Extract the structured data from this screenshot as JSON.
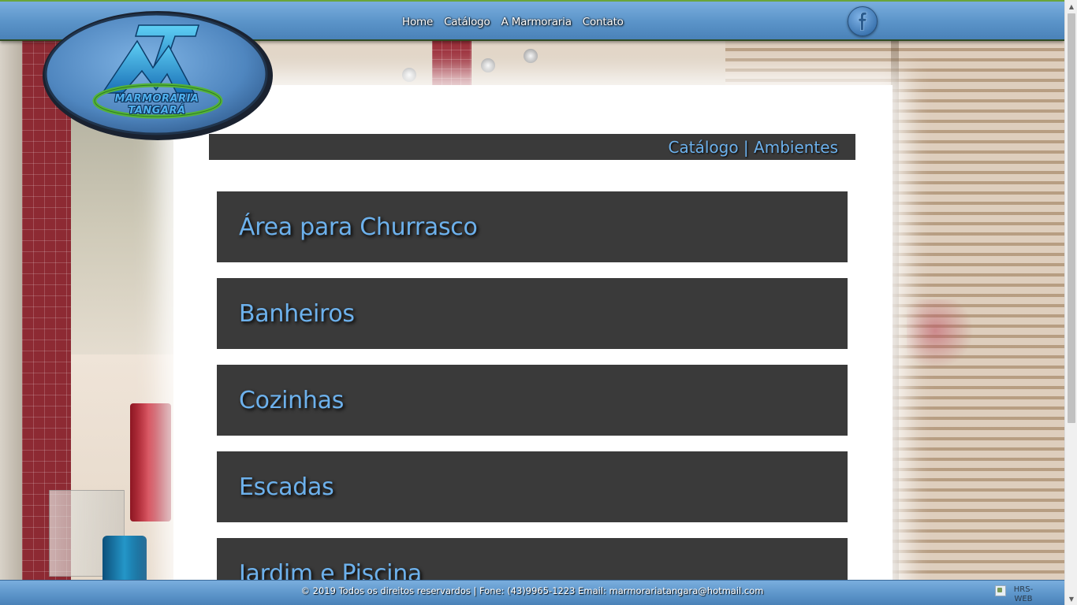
{
  "brand": {
    "logo_line1": "MARMORARIA",
    "logo_line2": "TANGARÁ",
    "logo_monogram": "TM"
  },
  "nav": {
    "items": [
      {
        "label": "Home"
      },
      {
        "label": "Catálogo"
      },
      {
        "label": "A Marmoraria"
      },
      {
        "label": "Contato"
      }
    ],
    "social_icon": "facebook-icon"
  },
  "breadcrumb": {
    "text": "Catálogo | Ambientes"
  },
  "categories": [
    {
      "label": "Área para Churrasco"
    },
    {
      "label": "Banheiros"
    },
    {
      "label": "Cozinhas"
    },
    {
      "label": "Escadas"
    },
    {
      "label": "Jardim e Piscina"
    }
  ],
  "footer": {
    "text": "© 2019 Todos os direitos reservardos | Fone: (43)9965-1223 Email: marmorariatangara@hotmail.com",
    "badge_alt": "HRS-WEB"
  },
  "colors": {
    "accent_blue": "#6db1ec",
    "panel_dark": "#3a3a3a",
    "header_blue": "#5a93c8",
    "header_border_green": "#6aa43a"
  }
}
